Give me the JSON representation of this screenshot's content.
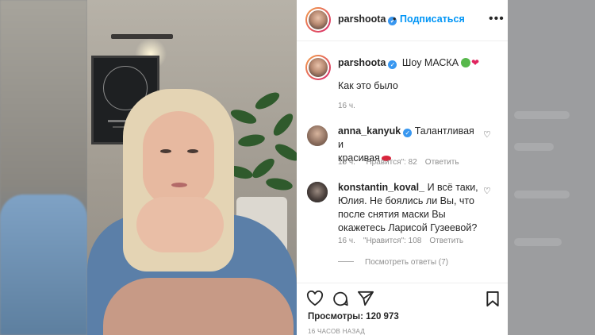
{
  "post": {
    "username": "parshoota",
    "follow_label": "Подписаться",
    "dot": "•",
    "more_icon": "more-dots-icon"
  },
  "caption": {
    "username": "parshoota",
    "text": "Шоу МАСКА",
    "line2": "Как это было",
    "time": "16 ч."
  },
  "comments": [
    {
      "username": "anna_kanyuk",
      "text_a": "Талантливая и",
      "text_b": "красивая",
      "time": "15 ч.",
      "likes": "\"Нравится\": 82",
      "reply": "Ответить"
    },
    {
      "username": "konstantin_koval_",
      "text_a": "И всё таки,",
      "text_b": "Юлия. Не боялись ли Вы, что",
      "text_c": "после снятия маски Вы",
      "text_d": "окажетесь Ларисой Гузеевой?",
      "time": "16 ч.",
      "likes": "\"Нравится\": 108",
      "reply": "Ответить"
    }
  ],
  "view_replies": "Посмотреть ответы (7)",
  "actions": {
    "views_label": "Просмотры:",
    "views_count": "120 973",
    "ago": "16 ЧАСОВ НАЗАД"
  },
  "colors": {
    "accent": "#0095f6",
    "text": "#262626",
    "muted": "#8e8e8e"
  }
}
